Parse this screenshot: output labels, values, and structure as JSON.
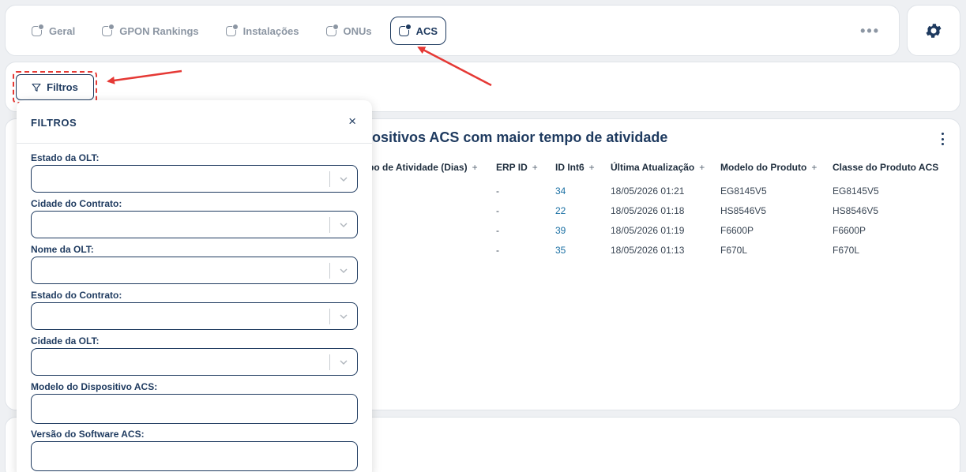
{
  "tabs": [
    {
      "label": "Geral"
    },
    {
      "label": "GPON Rankings"
    },
    {
      "label": "Instalações"
    },
    {
      "label": "ONUs"
    },
    {
      "label": "ACS"
    }
  ],
  "more_label": "•••",
  "filter_button": {
    "label": "Filtros"
  },
  "chart": {
    "title": "positivos ACS com maior tempo de atividade",
    "columns": [
      {
        "label": "po de Atividade (Dias)"
      },
      {
        "label": "ERP ID"
      },
      {
        "label": "ID Int6"
      },
      {
        "label": "Última Atualização"
      },
      {
        "label": "Modelo do Produto"
      },
      {
        "label": "Classe do Produto ACS"
      }
    ],
    "rows": [
      {
        "erp": "-",
        "id": "34",
        "updated": "18/05/2026 01:21",
        "model": "EG8145V5",
        "class": "EG8145V5"
      },
      {
        "erp": "-",
        "id": "22",
        "updated": "18/05/2026 01:18",
        "model": "HS8546V5",
        "class": "HS8546V5"
      },
      {
        "erp": "-",
        "id": "39",
        "updated": "18/05/2026 01:19",
        "model": "F6600P",
        "class": "F6600P"
      },
      {
        "erp": "-",
        "id": "35",
        "updated": "18/05/2026 01:13",
        "model": "F670L",
        "class": "F670L"
      }
    ]
  },
  "filters_panel": {
    "title": "FILTROS",
    "close": "×",
    "fields": [
      {
        "label": "Estado da OLT:"
      },
      {
        "label": "Cidade do Contrato:"
      },
      {
        "label": "Nome da OLT:"
      },
      {
        "label": "Estado do Contrato:"
      },
      {
        "label": "Cidade da OLT:"
      },
      {
        "label": "Modelo do Dispositivo ACS:"
      },
      {
        "label": "Versão do Software ACS:"
      }
    ]
  },
  "colors": {
    "primary": "#1e3a5f",
    "link": "#1a6fa3",
    "annotation": "#e53935",
    "muted": "#8c96a3"
  }
}
